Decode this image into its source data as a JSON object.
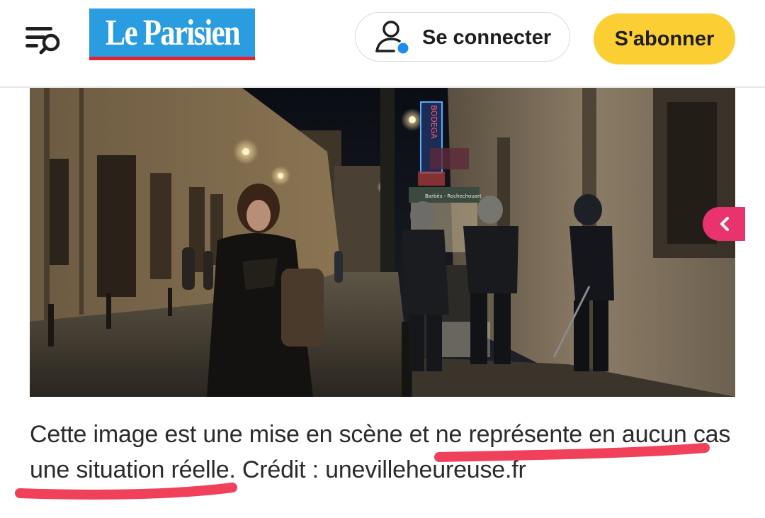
{
  "header": {
    "logo_text": "Le Parisien",
    "login_label": "Se connecter",
    "subscribe_label": "S'abonner",
    "icons": [
      "menu-search-icon",
      "user-icon",
      "chevron-left-icon"
    ]
  },
  "photo_signage": {
    "shop_sign": "BODEGA",
    "metro_sign": "Barbès - Rochechouart"
  },
  "article": {
    "caption": "Cette image est une mise en scène et ne représente en aucun cas une situation réelle. Crédit : unevilleheureuse.fr"
  },
  "colors": {
    "brand_blue": "#2a9de0",
    "brand_red": "#e52230",
    "subscribe_yellow": "#fbcf33",
    "presence_dot": "#1c8cf0",
    "side_tab_pink": "#e8336f",
    "highlight_underline": "#f0405a"
  }
}
